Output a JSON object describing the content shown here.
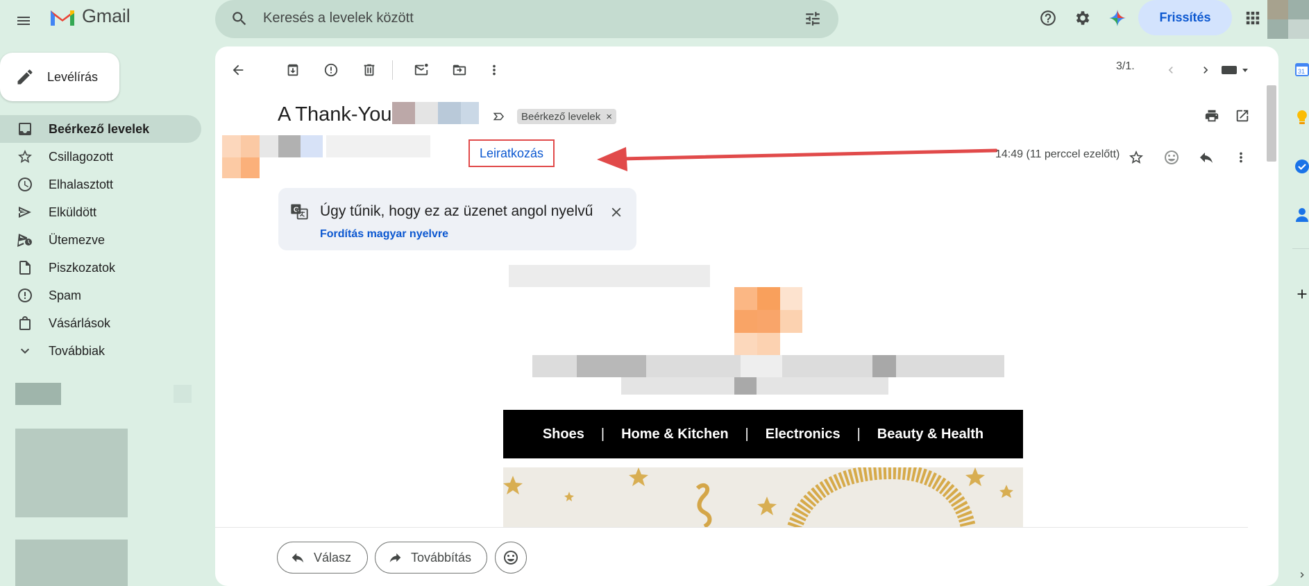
{
  "app": {
    "name": "Gmail"
  },
  "search": {
    "placeholder": "Keresés a levelek között"
  },
  "header": {
    "upgrade_label": "Frissítés"
  },
  "compose": {
    "label": "Levélírás"
  },
  "sidebar": {
    "items": [
      {
        "label": "Beérkező levelek",
        "icon": "inbox-icon",
        "active": true
      },
      {
        "label": "Csillagozott",
        "icon": "star-icon"
      },
      {
        "label": "Elhalasztott",
        "icon": "clock-icon"
      },
      {
        "label": "Elküldött",
        "icon": "send-icon"
      },
      {
        "label": "Ütemezve",
        "icon": "scheduled-icon"
      },
      {
        "label": "Piszkozatok",
        "icon": "draft-icon"
      },
      {
        "label": "Spam",
        "icon": "spam-icon"
      },
      {
        "label": "Vásárlások",
        "icon": "shopping-bag-icon"
      },
      {
        "label": "Továbbiak",
        "icon": "chevron-down-icon"
      }
    ]
  },
  "toolbar": {
    "pager": "3/1."
  },
  "message": {
    "subject": "A Thank-You,",
    "label_chip": "Beérkező levelek",
    "label_chip_close": "×",
    "unsubscribe": "Leiratkozás",
    "time": "14:49 (11 perccel ezelőtt)"
  },
  "translate": {
    "message": "Úgy tűnik, hogy ez az üzenet angol nyelvű",
    "link": "Fordítás magyar nyelvre"
  },
  "email_body": {
    "categories": [
      "Shoes",
      "Home & Kitchen",
      "Electronics",
      "Beauty & Health"
    ],
    "separator": "|"
  },
  "actions": {
    "reply": "Válasz",
    "forward": "Továbbítás"
  },
  "right_rail": {
    "calendar_day": "31"
  },
  "colors": {
    "accent": "#0b57d0",
    "annotation": "#e14a4a",
    "background": "#dcefe4"
  }
}
